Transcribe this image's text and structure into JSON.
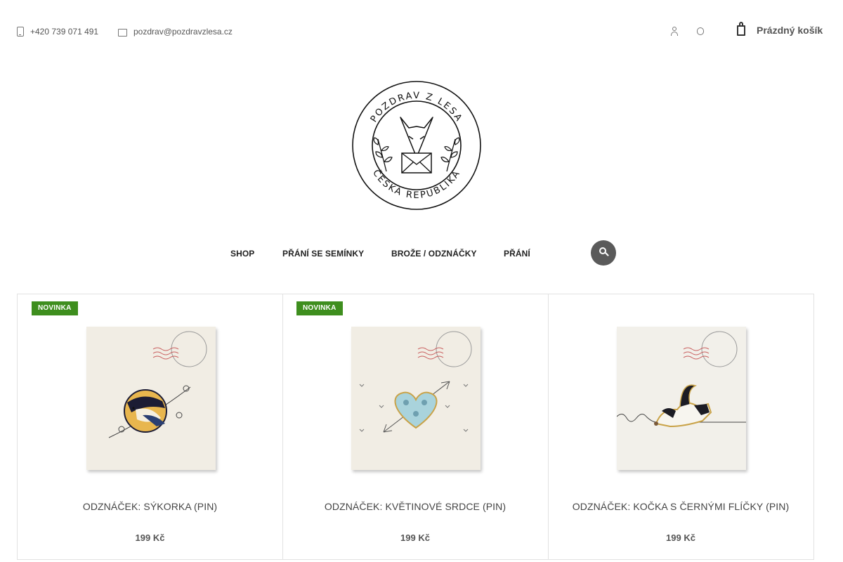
{
  "topbar": {
    "phone": "+420 739 071 491",
    "email": "pozdrav@pozdravzlesa.cz",
    "cart_label": "Prázdný košík"
  },
  "logo": {
    "top_text": "POZDRAV Z LESA",
    "bottom_text": "ČESKÁ REPUBLIKA"
  },
  "nav": {
    "items": [
      {
        "label": "SHOP"
      },
      {
        "label": "PŘÁNÍ SE SEMÍNKY"
      },
      {
        "label": "BROŽE / ODZNÁČKY"
      },
      {
        "label": "PŘÁNÍ"
      }
    ]
  },
  "products": [
    {
      "badge": "NOVINKA",
      "name": "ODZNÁČEK: SÝKORKA (PIN)",
      "price": "199 Kč"
    },
    {
      "badge": "NOVINKA",
      "name": "ODZNÁČEK: KVĚTINOVÉ SRDCE (PIN)",
      "price": "199 Kč"
    },
    {
      "badge": "",
      "name": "ODZNÁČEK: KOČKA S ČERNÝMI FLÍČKY (PIN)",
      "price": "199 Kč"
    }
  ],
  "colors": {
    "badge": "#3e8e1e",
    "search_button": "#5a5a5a",
    "text": "#444444"
  }
}
